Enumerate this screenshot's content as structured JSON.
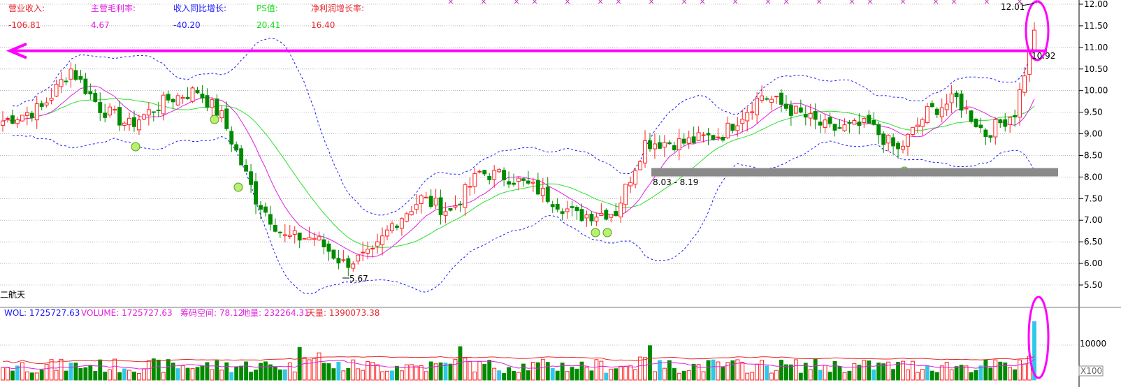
{
  "indicators": [
    {
      "label": "营业收入:",
      "value": "-106.81",
      "color": "#e8262e"
    },
    {
      "label": "主营毛利率:",
      "value": "4.67",
      "color": "#e020e0"
    },
    {
      "label": "收入同比增长:",
      "value": "-40.20",
      "color": "#1a1aff"
    },
    {
      "label": "PS值:",
      "value": "20.41",
      "color": "#18e018"
    },
    {
      "label": "净利润增长率:",
      "value": "16.40",
      "color": "#e8262e"
    }
  ],
  "stock_name_fragment": "二航天",
  "volume_header": [
    {
      "text": "WOL: 1725727.63",
      "color": "#1a1aff"
    },
    {
      "text": "VOLUME: 1725727.63",
      "color": "#e020e0"
    },
    {
      "text": "筹码空间: 78.12",
      "color": "#e020e0"
    },
    {
      "text": "地量: 232264.31",
      "color": "#e020e0"
    },
    {
      "text": "天量: 1390073.38",
      "color": "#e8262e"
    }
  ],
  "price_axis_ticks": [
    "12.00",
    "11.50",
    "11.00",
    "10.50",
    "10.00",
    "9.50",
    "9.00",
    "8.50",
    "8.00",
    "7.50",
    "7.00",
    "6.50",
    "6.00",
    "5.50"
  ],
  "volume_axis_tick": "10000",
  "volume_axis_unit": "X100",
  "annotations": {
    "high": "12.01",
    "level": "10.92",
    "low": "5.67",
    "support_range": "8.03 - 8.19"
  },
  "colors": {
    "up": "#ff2020",
    "down": "#008a00",
    "ma": "#30dd30",
    "mid": "#e020e0",
    "band": "#1a1aff",
    "highlight": "#ff00ff",
    "support": "#8a8a8a"
  },
  "chart_data": {
    "type": "candlestick",
    "y_range": [
      5.2,
      12.1
    ],
    "resistance_level": 10.92,
    "support_zone": [
      8.03,
      8.19
    ],
    "marked_values": {
      "high": 12.01,
      "low": 5.67
    },
    "trend_keypoints": [
      {
        "bar": 0,
        "close": 9.3
      },
      {
        "bar": 8,
        "close": 9.6
      },
      {
        "bar": 14,
        "close": 10.5
      },
      {
        "bar": 20,
        "close": 9.6
      },
      {
        "bar": 26,
        "close": 9.2
      },
      {
        "bar": 34,
        "close": 9.8
      },
      {
        "bar": 40,
        "close": 10.0
      },
      {
        "bar": 45,
        "close": 9.4
      },
      {
        "bar": 52,
        "close": 7.5
      },
      {
        "bar": 58,
        "close": 6.6
      },
      {
        "bar": 64,
        "close": 6.6
      },
      {
        "bar": 70,
        "close": 6.0
      },
      {
        "bar": 76,
        "close": 6.2
      },
      {
        "bar": 80,
        "close": 6.9
      },
      {
        "bar": 86,
        "close": 7.5
      },
      {
        "bar": 92,
        "close": 7.2
      },
      {
        "bar": 98,
        "close": 8.1
      },
      {
        "bar": 104,
        "close": 8.0
      },
      {
        "bar": 110,
        "close": 7.7
      },
      {
        "bar": 118,
        "close": 7.1
      },
      {
        "bar": 126,
        "close": 7.2
      },
      {
        "bar": 132,
        "close": 8.8
      },
      {
        "bar": 140,
        "close": 8.8
      },
      {
        "bar": 148,
        "close": 9.0
      },
      {
        "bar": 156,
        "close": 9.9
      },
      {
        "bar": 163,
        "close": 9.5
      },
      {
        "bar": 170,
        "close": 9.1
      },
      {
        "bar": 178,
        "close": 9.2
      },
      {
        "bar": 184,
        "close": 8.6
      },
      {
        "bar": 190,
        "close": 9.5
      },
      {
        "bar": 196,
        "close": 9.8
      },
      {
        "bar": 202,
        "close": 9.0
      },
      {
        "bar": 208,
        "close": 9.5
      },
      {
        "bar": 211,
        "close": 10.9
      },
      {
        "bar": 212,
        "close": 11.4
      }
    ]
  }
}
